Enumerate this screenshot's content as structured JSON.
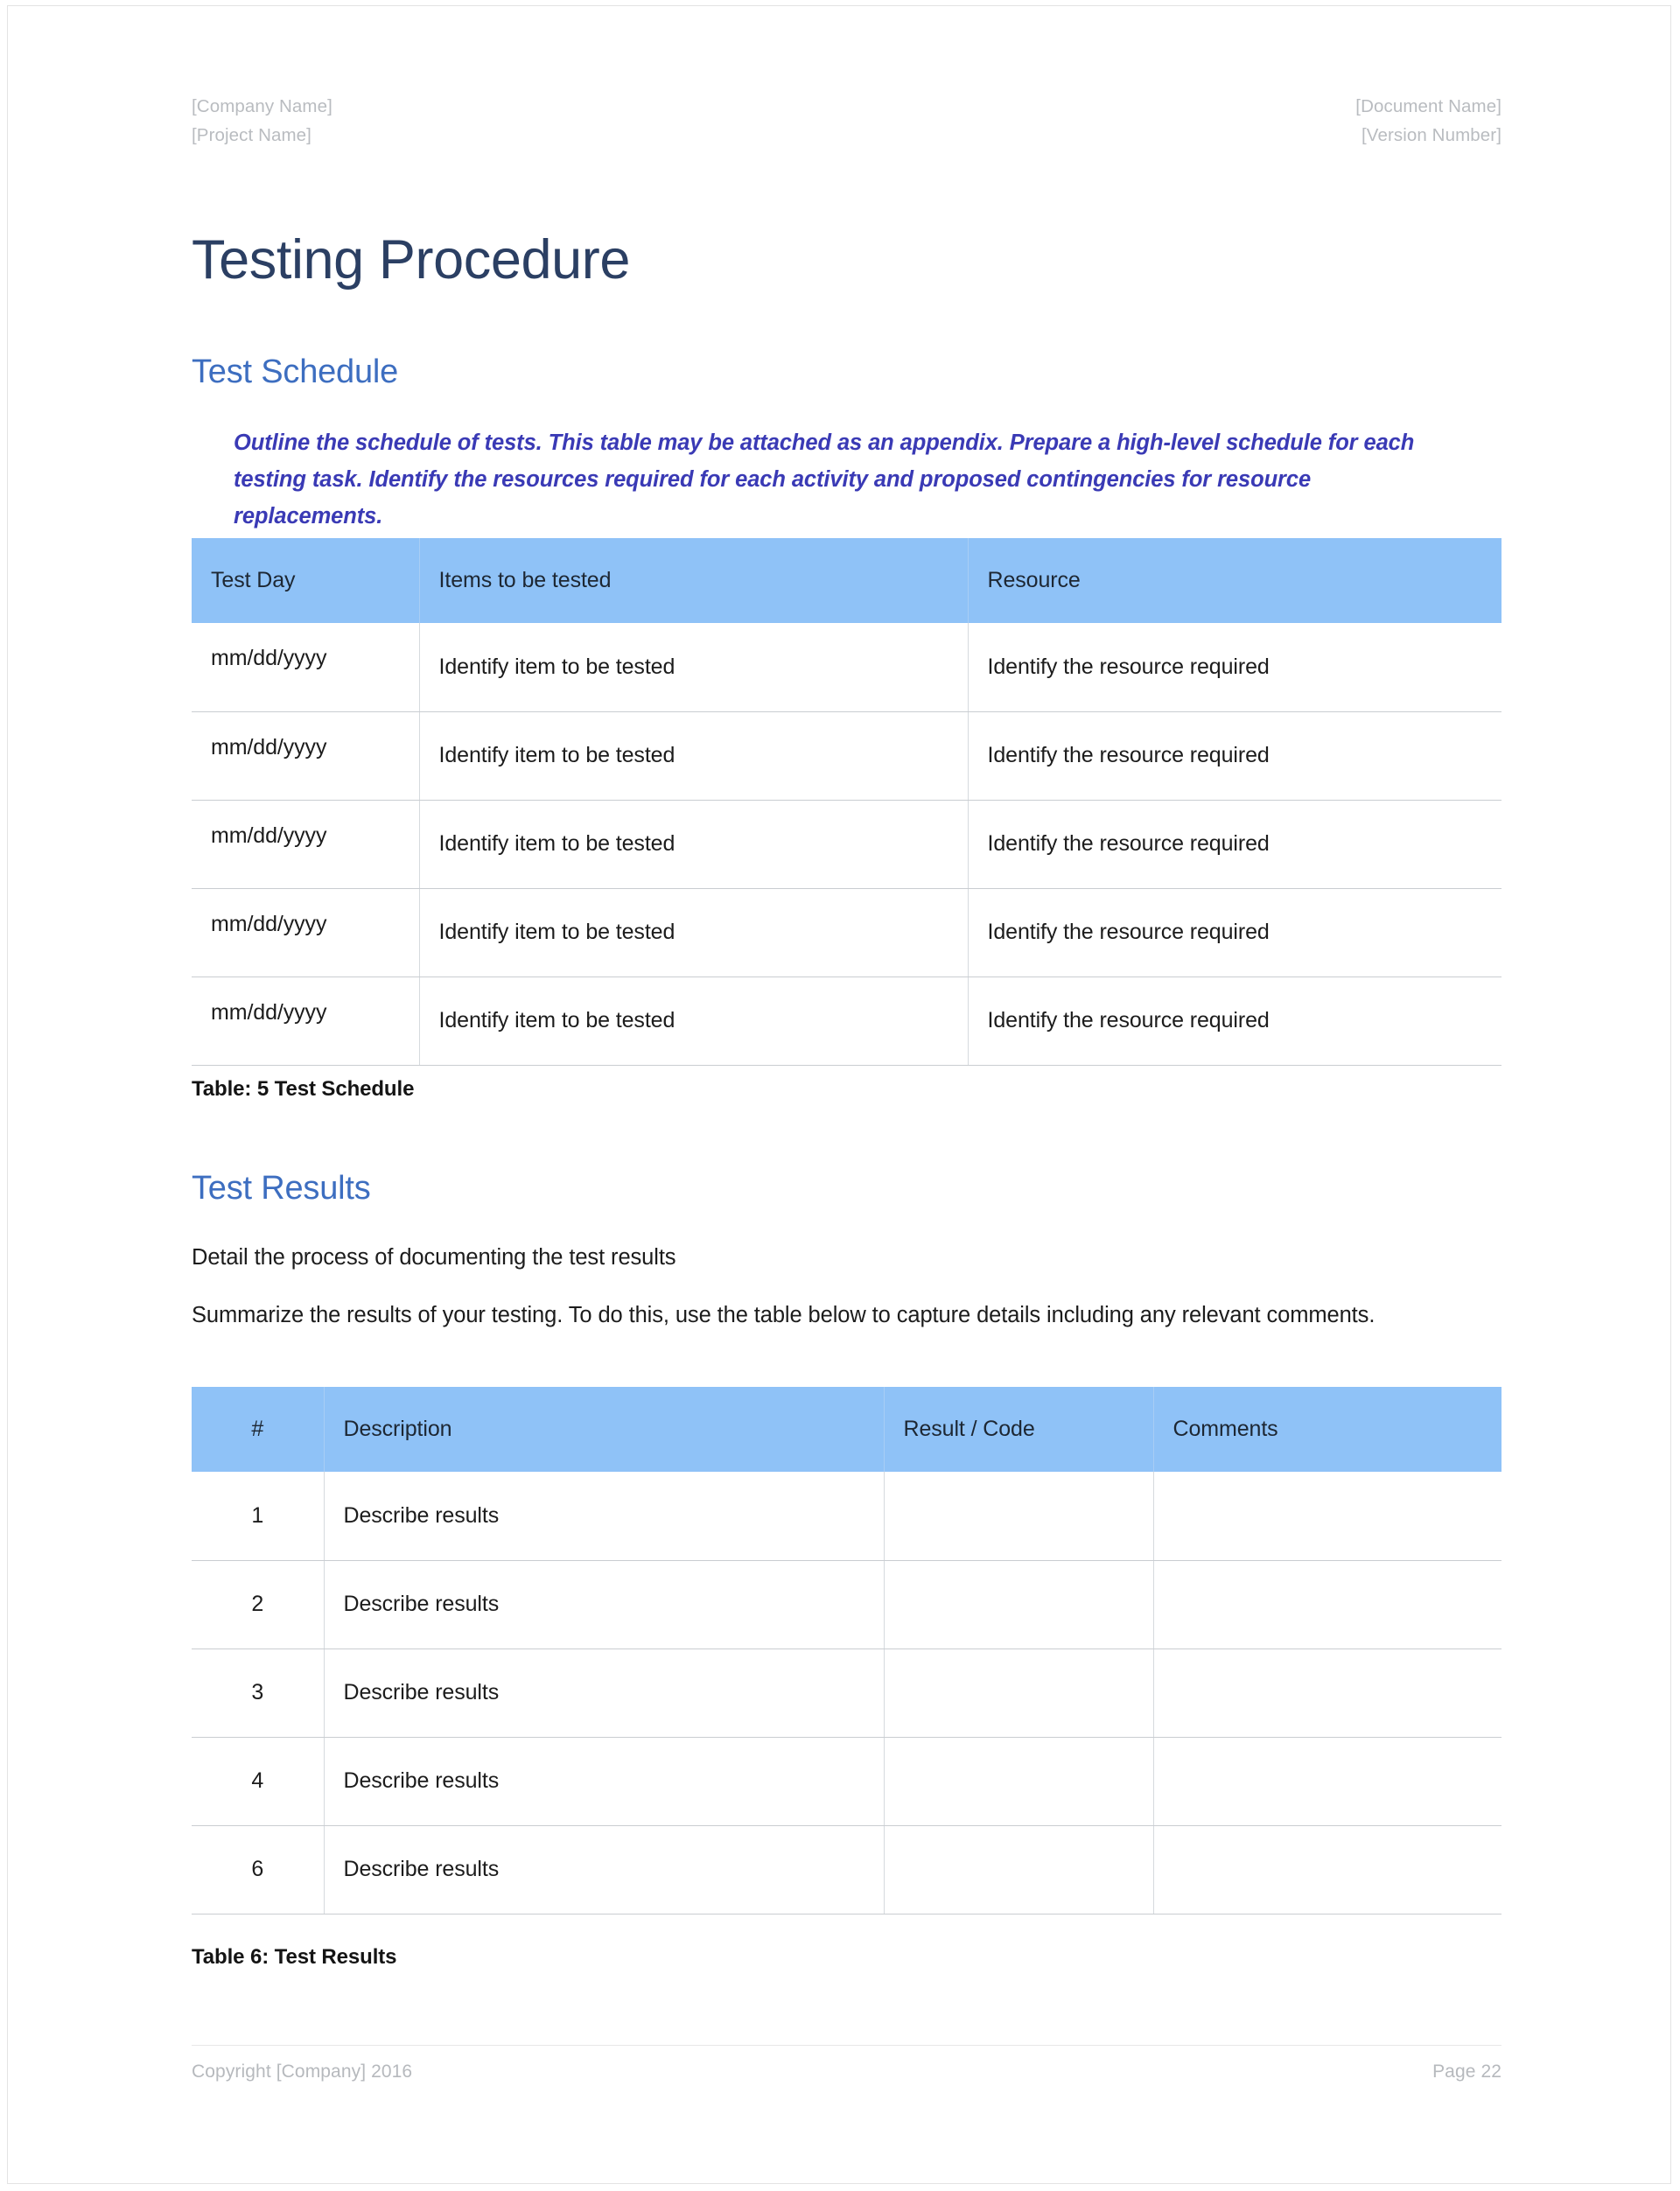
{
  "page": {
    "running_header": {
      "left_line1": "[Company Name]",
      "left_line2": "[Project Name]",
      "right_line1": "[Document Name]",
      "right_line2": "[Version Number]"
    },
    "title": "Testing Procedure",
    "footer": {
      "copyright": "Copyright [Company] 2016",
      "page_label": "Page 22"
    },
    "colors": {
      "title": "#2b3f63",
      "heading": "#3d6ec0",
      "instruction": "#3a3ab5",
      "table_header_bg": "#8fc2f7",
      "body_text": "#1c1c1c",
      "muted": "#b9bcc0"
    }
  },
  "sections": {
    "test_schedule": {
      "heading": "Test Schedule",
      "instruction": "Outline the schedule of tests. This table may be attached as an appendix. Prepare a high-level schedule for each testing task. Identify the resources required for each activity and proposed contingencies for resource replacements.",
      "caption": "Table: 5 Test Schedule",
      "table": {
        "columns": [
          "Test Day",
          "Items to be tested",
          "Resource"
        ],
        "rows": [
          [
            "mm/dd/yyyy",
            "Identify item to be tested",
            "Identify the resource required"
          ],
          [
            "mm/dd/yyyy",
            "Identify item to be tested",
            "Identify the resource required"
          ],
          [
            "mm/dd/yyyy",
            "Identify item to be tested",
            "Identify the resource required"
          ],
          [
            "mm/dd/yyyy",
            "Identify item to be tested",
            "Identify the resource required"
          ],
          [
            "mm/dd/yyyy",
            "Identify item to be tested",
            "Identify the resource required"
          ]
        ]
      }
    },
    "test_results": {
      "heading": "Test Results",
      "paragraph_1": "Detail the process of documenting the test results",
      "paragraph_2": "Summarize the results of your testing. To do this, use the table below to capture details including any relevant comments.",
      "caption": "Table 6: Test Results",
      "table": {
        "columns": [
          "#",
          "Description",
          "Result / Code",
          "Comments"
        ],
        "rows": [
          [
            "1",
            "Describe results",
            "",
            ""
          ],
          [
            "2",
            "Describe results",
            "",
            ""
          ],
          [
            "3",
            "Describe results",
            "",
            ""
          ],
          [
            "4",
            "Describe results",
            "",
            ""
          ],
          [
            "6",
            "Describe results",
            "",
            ""
          ]
        ]
      }
    }
  }
}
